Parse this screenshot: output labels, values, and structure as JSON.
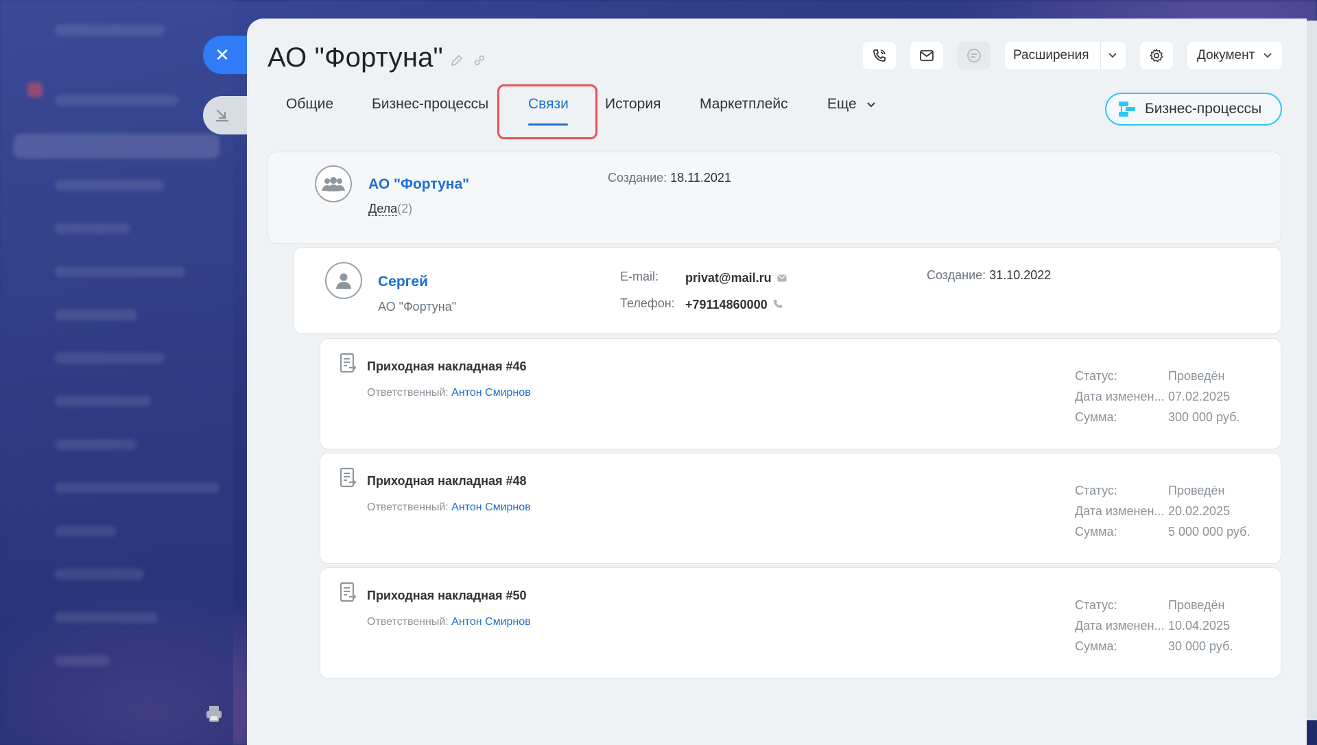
{
  "header": {
    "title": "АО \"Фортуна\"",
    "extensions_label": "Расширения",
    "document_label": "Документ"
  },
  "tabs": [
    {
      "label": "Общие"
    },
    {
      "label": "Бизнес-процессы"
    },
    {
      "label": "Связи",
      "active": true
    },
    {
      "label": "История"
    },
    {
      "label": "Маркетплейс"
    },
    {
      "label": "Еще"
    }
  ],
  "bp_button": {
    "label": "Бизнес-процессы"
  },
  "company": {
    "name": "АО \"Фортуна\"",
    "deals_label": "Дела",
    "deals_count": "(2)",
    "created_label": "Создание:",
    "created_value": "18.11.2021"
  },
  "contact": {
    "name": "Сергей",
    "company": "АО \"Фортуна\"",
    "email_label": "E-mail:",
    "email_value": "privat@mail.ru",
    "phone_label": "Телефон:",
    "phone_value": "+79114860000",
    "created_label": "Создание:",
    "created_value": "31.10.2022"
  },
  "documents": [
    {
      "title": "Приходная накладная #46",
      "responsible_label": "Ответственный:",
      "responsible_name": "Антон Смирнов",
      "status_label": "Статус:",
      "status_value": "Проведён",
      "date_label": "Дата изменен...",
      "date_value": "07.02.2025",
      "sum_label": "Сумма:",
      "sum_value": "300 000 руб."
    },
    {
      "title": "Приходная накладная #48",
      "responsible_label": "Ответственный:",
      "responsible_name": "Антон Смирнов",
      "status_label": "Статус:",
      "status_value": "Проведён",
      "date_label": "Дата изменен...",
      "date_value": "20.02.2025",
      "sum_label": "Сумма:",
      "sum_value": "5 000 000 руб."
    },
    {
      "title": "Приходная накладная #50",
      "responsible_label": "Ответственный:",
      "responsible_name": "Антон Смирнов",
      "status_label": "Статус:",
      "status_value": "Проведён",
      "date_label": "Дата изменен...",
      "date_value": "10.04.2025",
      "sum_label": "Сумма:",
      "sum_value": "30 000 руб."
    }
  ],
  "colors": {
    "accent": "#1e6fce",
    "close_button": "#2f7cf6",
    "highlight": "#e4575a",
    "bp_border": "#2fc6f6"
  }
}
